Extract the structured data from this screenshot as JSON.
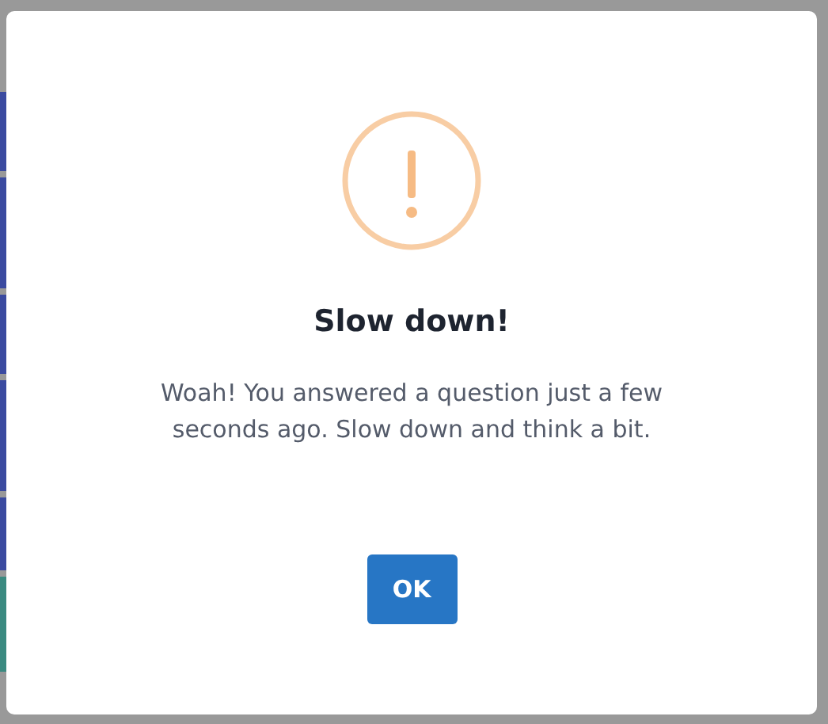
{
  "dialog": {
    "icon": {
      "kind": "warning"
    },
    "title": "Slow down!",
    "message": "Woah! You answered a question just a few seconds ago. Slow down and think a bit.",
    "buttons": [
      {
        "label": "OK"
      }
    ]
  }
}
